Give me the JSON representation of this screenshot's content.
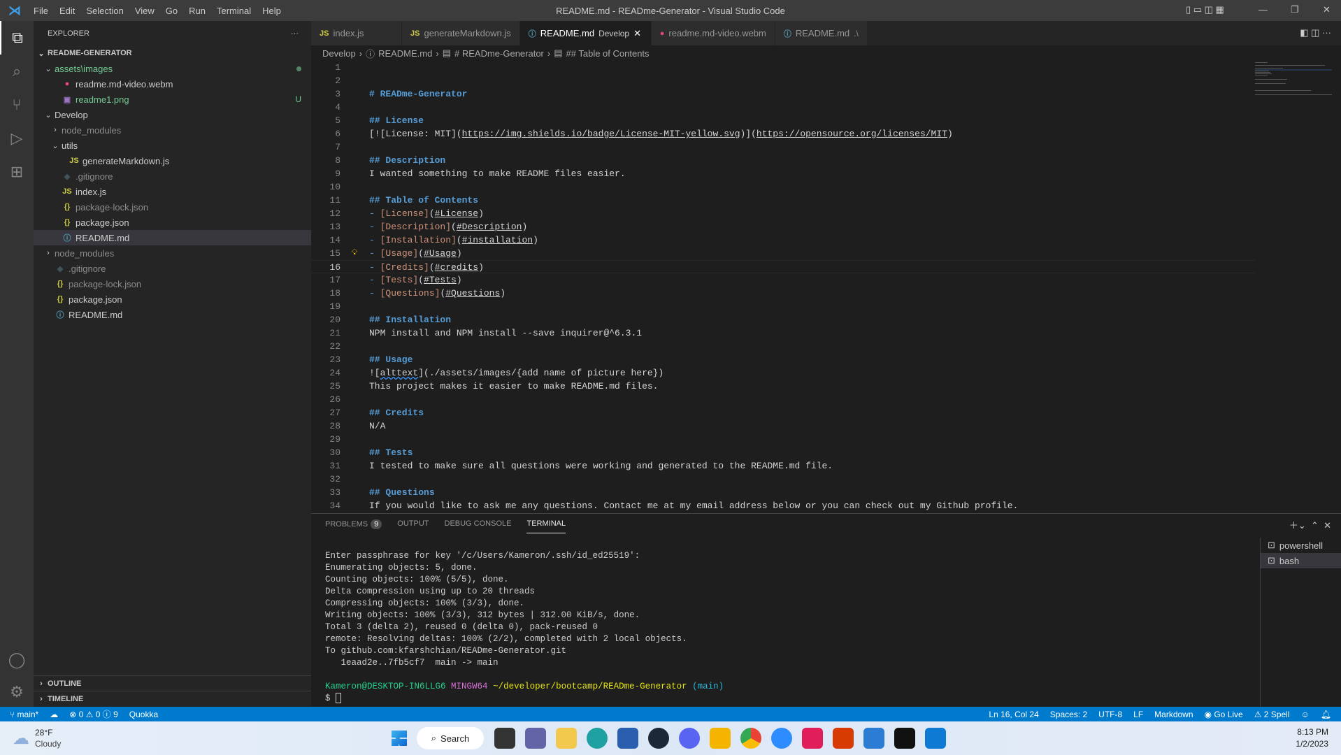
{
  "titlebar": {
    "menus": [
      "File",
      "Edit",
      "Selection",
      "View",
      "Go",
      "Run",
      "Terminal",
      "Help"
    ],
    "title": "README.md - READme-Generator - Visual Studio Code"
  },
  "sidebar": {
    "title": "EXPLORER",
    "more": "···",
    "root": "README-GENERATOR",
    "outline": "OUTLINE",
    "timeline": "TIMELINE",
    "items": [
      {
        "label": "assets\\images",
        "indent": 1,
        "kind": "folder-open",
        "color": "#73c991",
        "dot": true
      },
      {
        "label": "readme.md-video.webm",
        "indent": 2,
        "kind": "video",
        "color": "#cccccc"
      },
      {
        "label": "readme1.png",
        "indent": 2,
        "kind": "image",
        "color": "#73c991",
        "badge": "U"
      },
      {
        "label": "Develop",
        "indent": 1,
        "kind": "folder-open",
        "color": "#cccccc"
      },
      {
        "label": "node_modules",
        "indent": 2,
        "kind": "folder",
        "color": "#8c8c8c"
      },
      {
        "label": "utils",
        "indent": 2,
        "kind": "folder-open",
        "color": "#cccccc"
      },
      {
        "label": "generateMarkdown.js",
        "indent": 3,
        "kind": "js",
        "color": "#cccccc"
      },
      {
        "label": ".gitignore",
        "indent": 2,
        "kind": "git",
        "color": "#8c8c8c"
      },
      {
        "label": "index.js",
        "indent": 2,
        "kind": "js",
        "color": "#cccccc"
      },
      {
        "label": "package-lock.json",
        "indent": 2,
        "kind": "json",
        "color": "#8c8c8c"
      },
      {
        "label": "package.json",
        "indent": 2,
        "kind": "json",
        "color": "#cccccc"
      },
      {
        "label": "README.md",
        "indent": 2,
        "kind": "info",
        "color": "#cccccc",
        "selected": true
      },
      {
        "label": "node_modules",
        "indent": 1,
        "kind": "folder",
        "color": "#8c8c8c"
      },
      {
        "label": ".gitignore",
        "indent": 1,
        "kind": "git",
        "color": "#8c8c8c"
      },
      {
        "label": "package-lock.json",
        "indent": 1,
        "kind": "json",
        "color": "#8c8c8c"
      },
      {
        "label": "package.json",
        "indent": 1,
        "kind": "json",
        "color": "#cccccc"
      },
      {
        "label": "README.md",
        "indent": 1,
        "kind": "info",
        "color": "#cccccc"
      }
    ]
  },
  "tabs": [
    {
      "label": "index.js",
      "kind": "js"
    },
    {
      "label": "generateMarkdown.js",
      "kind": "js"
    },
    {
      "label": "README.md",
      "desc": "Develop",
      "kind": "info",
      "active": true
    },
    {
      "label": "readme.md-video.webm",
      "kind": "video"
    },
    {
      "label": "README.md",
      "desc": ".\\",
      "kind": "info"
    }
  ],
  "breadcrumb": [
    "Develop",
    "README.md",
    "# READme-Generator",
    "## Table of Contents"
  ],
  "editor": {
    "current_line": 16,
    "lines": [
      [],
      [],
      [
        [
          "# READme-Generator",
          "h"
        ]
      ],
      [],
      [
        [
          "## License",
          "h"
        ]
      ],
      [
        [
          "[![License: MIT](",
          "t"
        ],
        [
          "https://img.shields.io/badge/License-MIT-yellow.svg",
          "u"
        ],
        [
          ")](",
          "t"
        ],
        [
          "https://opensource.org/licenses/MIT",
          "u"
        ],
        [
          ")",
          "t"
        ]
      ],
      [],
      [
        [
          "## Description",
          "h"
        ]
      ],
      [
        [
          "I wanted something to make README files easier.",
          "t"
        ]
      ],
      [],
      [
        [
          "## Table of Contents",
          "h"
        ]
      ],
      [
        [
          "- ",
          "m"
        ],
        [
          "[License]",
          "lk"
        ],
        [
          "(",
          "t"
        ],
        [
          "#License",
          "u"
        ],
        [
          ")",
          "t"
        ]
      ],
      [
        [
          "- ",
          "m"
        ],
        [
          "[Description]",
          "lk"
        ],
        [
          "(",
          "t"
        ],
        [
          "#Description",
          "u"
        ],
        [
          ")",
          "t"
        ]
      ],
      [
        [
          "- ",
          "m"
        ],
        [
          "[Installation]",
          "lk"
        ],
        [
          "(",
          "t"
        ],
        [
          "#installation",
          "u"
        ],
        [
          ")",
          "t"
        ]
      ],
      [
        [
          "- ",
          "m"
        ],
        [
          "[Usage]",
          "lk"
        ],
        [
          "(",
          "t"
        ],
        [
          "#Usage",
          "u"
        ],
        [
          ")",
          "t"
        ]
      ],
      [
        [
          "- ",
          "m"
        ],
        [
          "[Credits]",
          "lk"
        ],
        [
          "(",
          "t"
        ],
        [
          "#credits",
          "u"
        ],
        [
          ")",
          "t"
        ]
      ],
      [
        [
          "- ",
          "m"
        ],
        [
          "[Tests]",
          "lk"
        ],
        [
          "(",
          "t"
        ],
        [
          "#Tests",
          "u"
        ],
        [
          ")",
          "t"
        ]
      ],
      [
        [
          "- ",
          "m"
        ],
        [
          "[Questions]",
          "lk"
        ],
        [
          "(",
          "t"
        ],
        [
          "#Questions",
          "u"
        ],
        [
          ")",
          "t"
        ]
      ],
      [],
      [
        [
          "## Installation",
          "h"
        ]
      ],
      [
        [
          "NPM install and NPM install --save inquirer@^6.3.1",
          "t"
        ]
      ],
      [],
      [
        [
          "## Usage",
          "h"
        ]
      ],
      [
        [
          "![",
          "t"
        ],
        [
          "alttext",
          "sq"
        ],
        [
          "](./assets/images/{add name of picture here})",
          "t"
        ]
      ],
      [
        [
          "This project makes it easier to make README.md files.",
          "t"
        ]
      ],
      [],
      [
        [
          "## Credits",
          "h"
        ]
      ],
      [
        [
          "N/A",
          "t"
        ]
      ],
      [],
      [
        [
          "## Tests",
          "h"
        ]
      ],
      [
        [
          "I tested to make sure all questions were working and generated to the README.md file.",
          "t"
        ]
      ],
      [],
      [
        [
          "## Questions",
          "h"
        ]
      ],
      [
        [
          "If you would like to ask me any questions. Contact me at my email address below or you can check out my Github profile.",
          "t"
        ]
      ]
    ]
  },
  "panel": {
    "tabs": [
      "PROBLEMS",
      "OUTPUT",
      "DEBUG CONSOLE",
      "TERMINAL"
    ],
    "problems_count": "9",
    "active_tab": "TERMINAL",
    "terminal_lines": [
      "Enter passphrase for key '/c/Users/Kameron/.ssh/id_ed25519':",
      "Enumerating objects: 5, done.",
      "Counting objects: 100% (5/5), done.",
      "Delta compression using up to 20 threads",
      "Compressing objects: 100% (3/3), done.",
      "Writing objects: 100% (3/3), 312 bytes | 312.00 KiB/s, done.",
      "Total 3 (delta 2), reused 0 (delta 0), pack-reused 0",
      "remote: Resolving deltas: 100% (2/2), completed with 2 local objects.",
      "To github.com:kfarshchian/READme-Generator.git",
      "   1eaad2e..7fb5cf7  main -> main",
      ""
    ],
    "prompt": {
      "user": "Kameron@DESKTOP-IN6LLG6",
      "shell": "MINGW64",
      "path": "~/developer/bootcamp/READme-Generator",
      "branch": "(main)",
      "symbol": "$"
    },
    "terminals": [
      "powershell",
      "bash"
    ]
  },
  "status": {
    "branch": "main*",
    "errors": "0",
    "warnings": "0",
    "info": "9",
    "quokka": "Quokka",
    "position": "Ln 16, Col 24",
    "spaces": "Spaces: 2",
    "encoding": "UTF-8",
    "eol": "LF",
    "language": "Markdown",
    "golive": "Go Live",
    "spell": "2 Spell"
  },
  "taskbar": {
    "temp": "28°F",
    "weather": "Cloudy",
    "search": "Search",
    "time": "8:13 PM",
    "date": "1/2/2023"
  },
  "colors": {
    "accent": "#007acc",
    "activity": "#333333",
    "sidebar": "#252526"
  }
}
